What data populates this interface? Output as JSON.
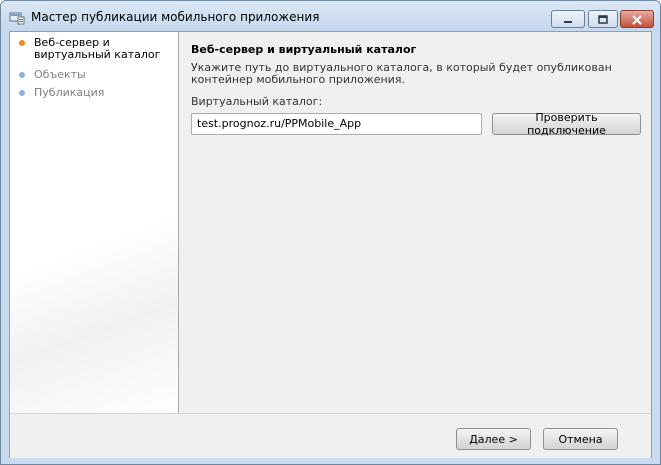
{
  "window": {
    "title": "Мастер публикации мобильного приложения",
    "controls": [
      "minimize-icon",
      "maximize-icon",
      "close-icon"
    ]
  },
  "steps": [
    {
      "label": "Веб-сервер и виртуальный каталог",
      "state": "active",
      "color": "#f08a24"
    },
    {
      "label": "Объекты",
      "state": "pending",
      "color": "#8fb3dc"
    },
    {
      "label": "Публикация",
      "state": "pending",
      "color": "#8fb3dc"
    }
  ],
  "page": {
    "heading": "Веб-сервер и виртуальный каталог",
    "description": "Укажите путь до виртуального каталога, в который будет опубликован контейнер мобильного приложения.",
    "field_label": "Виртуальный каталог:",
    "field_value": "test.prognoz.ru/PPMobile_App",
    "check_button": "Проверить подключение"
  },
  "footer": {
    "next_label": "Далее >",
    "cancel_label": "Отмена"
  },
  "colors": {
    "active_step": "#f08a24",
    "inactive_step_text": "#808080",
    "inactive_step_dot": "#8fb3dc",
    "close_button": "#c4523e"
  }
}
